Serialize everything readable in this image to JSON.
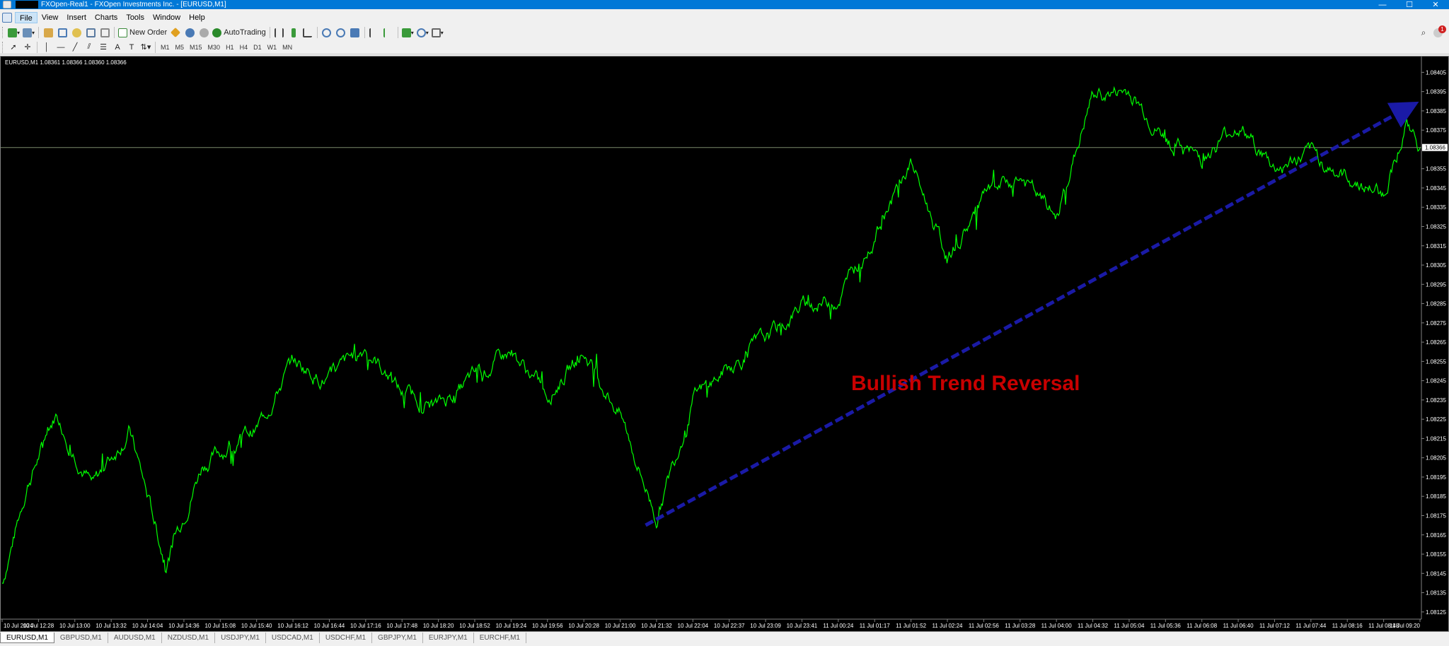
{
  "window": {
    "title": "FXOpen-Real1 - FXOpen Investments Inc. - [EURUSD,M1]",
    "controls": [
      "—",
      "☐",
      "✕"
    ]
  },
  "menu": [
    "File",
    "View",
    "Insert",
    "Charts",
    "Tools",
    "Window",
    "Help"
  ],
  "toolbar": {
    "new_order": "New Order",
    "autotrading": "AutoTrading",
    "timeframes": [
      "M1",
      "M5",
      "M15",
      "M30",
      "H1",
      "H4",
      "D1",
      "W1",
      "MN"
    ],
    "notification_count": "1"
  },
  "chart_info": "EURUSD,M1  1.08361 1.08366 1.08360 1.08366",
  "annotation": "Bullish Trend Reversal",
  "colors": {
    "price_line": "#00ff00",
    "trend_arrow": "#1a1aa6",
    "annotation_text": "#c80000",
    "background": "#000000",
    "axis_text": "#ffffff",
    "current_price_line": "#7a8a6a"
  },
  "chart_data": {
    "type": "line",
    "symbol": "EURUSD",
    "timeframe": "M1",
    "y_ticks": [
      "1.08405",
      "1.08395",
      "1.08385",
      "1.08375",
      "1.08355",
      "1.08345",
      "1.08335",
      "1.08325",
      "1.08315",
      "1.08305",
      "1.08295",
      "1.08285",
      "1.08275",
      "1.08265",
      "1.08255",
      "1.08245",
      "1.08235",
      "1.08225",
      "1.08215",
      "1.08205",
      "1.08195",
      "1.08185",
      "1.08175",
      "1.08165",
      "1.08155",
      "1.08145",
      "1.08135",
      "1.08125"
    ],
    "ylim": [
      1.08122,
      1.08411
    ],
    "current_price": "1.08366",
    "x_ticks": [
      "10 Jul 2024",
      "10 Jul 12:28",
      "10 Jul 13:00",
      "10 Jul 13:32",
      "10 Jul 14:04",
      "10 Jul 14:36",
      "10 Jul 15:08",
      "10 Jul 15:40",
      "10 Jul 16:12",
      "10 Jul 16:44",
      "10 Jul 17:16",
      "10 Jul 17:48",
      "10 Jul 18:20",
      "10 Jul 18:52",
      "10 Jul 19:24",
      "10 Jul 19:56",
      "10 Jul 20:28",
      "10 Jul 21:00",
      "10 Jul 21:32",
      "10 Jul 22:04",
      "10 Jul 22:37",
      "10 Jul 23:09",
      "10 Jul 23:41",
      "11 Jul 00:24",
      "11 Jul 01:17",
      "11 Jul 01:52",
      "11 Jul 02:24",
      "11 Jul 02:56",
      "11 Jul 03:28",
      "11 Jul 04:00",
      "11 Jul 04:32",
      "11 Jul 05:04",
      "11 Jul 05:36",
      "11 Jul 06:08",
      "11 Jul 06:40",
      "11 Jul 07:12",
      "11 Jul 07:44",
      "11 Jul 08:16",
      "11 Jul 08:48",
      "11 Jul 09:20"
    ],
    "series": [
      {
        "x": [
          0,
          0.7,
          1.5,
          2.5,
          3.5,
          4.5,
          5.5,
          7,
          8,
          9,
          10,
          11,
          12,
          13,
          14,
          15,
          16,
          17,
          18,
          19,
          20,
          21,
          22,
          23,
          24,
          25,
          26,
          27,
          28,
          29,
          30,
          31,
          32,
          33,
          34,
          35,
          36,
          37,
          38,
          38.6,
          39
        ],
        "values": [
          1.0814,
          1.08192,
          1.08228,
          1.0819,
          1.0822,
          1.0815,
          1.08202,
          1.0822,
          1.08255,
          1.08245,
          1.08263,
          1.08238,
          1.08232,
          1.08247,
          1.0826,
          1.08238,
          1.0826,
          1.08228,
          1.08174,
          1.08235,
          1.08252,
          1.08266,
          1.08284,
          1.08288,
          1.0832,
          1.08358,
          1.08308,
          1.0834,
          1.0835,
          1.0833,
          1.08393,
          1.08395,
          1.0837,
          1.0836,
          1.08378,
          1.08355,
          1.08362,
          1.0835,
          1.08342,
          1.08378,
          1.08366
        ]
      }
    ],
    "trend_arrow": {
      "from": {
        "x": 17.7,
        "y": 1.0817
      },
      "to": {
        "x": 38.8,
        "y": 1.08388
      }
    }
  },
  "symbol_tabs": [
    "EURUSD,M1",
    "GBPUSD,M1",
    "AUDUSD,M1",
    "NZDUSD,M1",
    "USDJPY,M1",
    "USDCAD,M1",
    "USDCHF,M1",
    "GBPJPY,M1",
    "EURJPY,M1",
    "EURCHF,M1"
  ]
}
